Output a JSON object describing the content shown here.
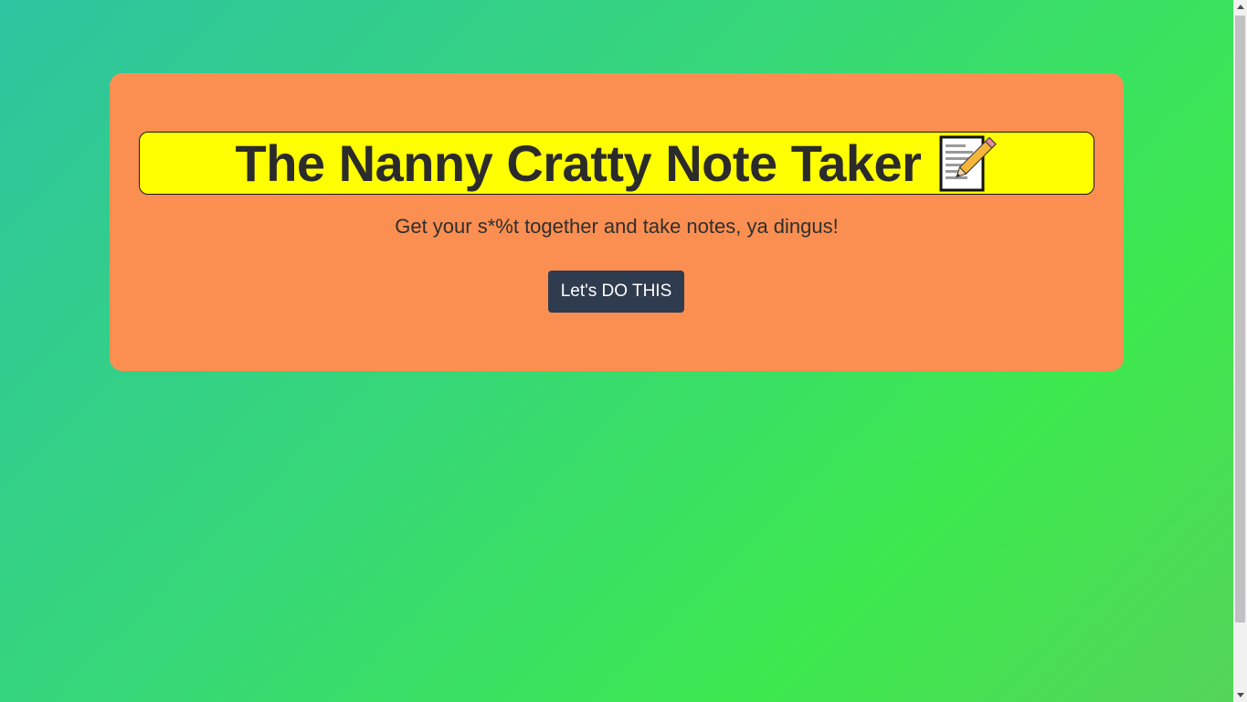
{
  "header": {
    "title": "The Nanny Cratty Note Taker",
    "title_icon": "memo-pencil-icon",
    "subtitle": "Get your s*%t together and take notes, ya dingus!"
  },
  "actions": {
    "start_label": "Let's DO THIS"
  },
  "colors": {
    "background_gradient": [
      "#2ec4a0",
      "#3de84e"
    ],
    "card": "#fb8f51",
    "title_highlight": "#ffff00",
    "button": "#2f3b4f"
  }
}
